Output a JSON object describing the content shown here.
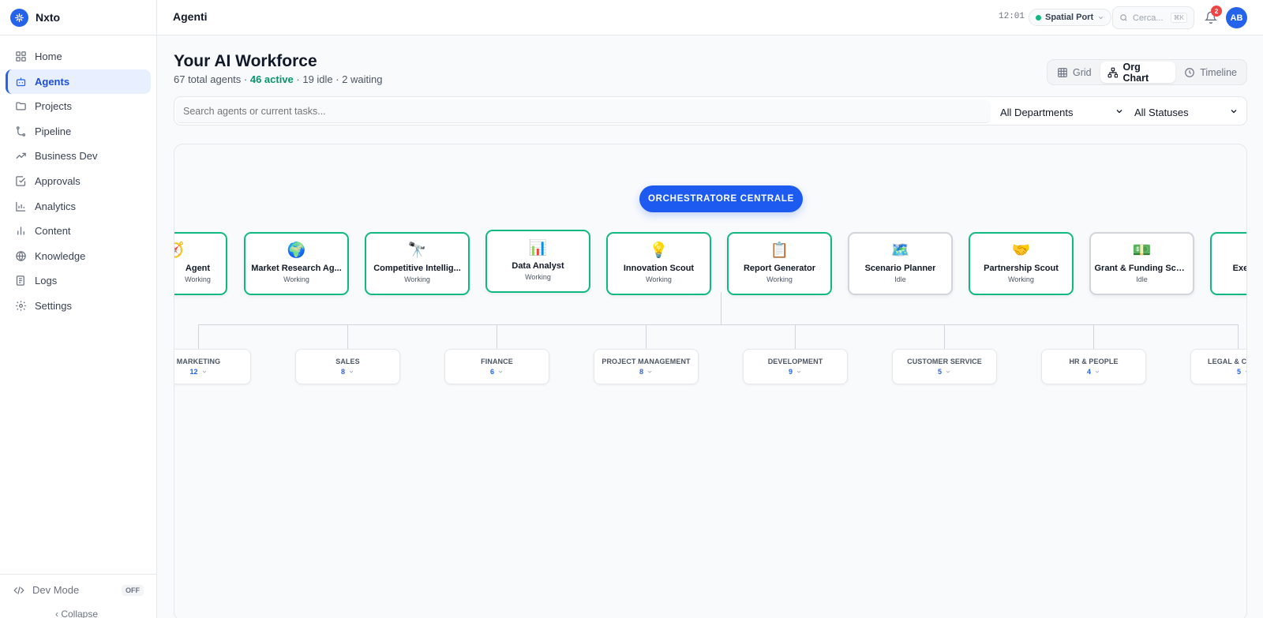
{
  "brand": {
    "name": "Nxto"
  },
  "sidebar": {
    "items": [
      {
        "label": "Home",
        "icon": "grid-icon"
      },
      {
        "label": "Agents",
        "icon": "bot-icon",
        "active": true
      },
      {
        "label": "Projects",
        "icon": "folder-icon"
      },
      {
        "label": "Pipeline",
        "icon": "git-branch-icon"
      },
      {
        "label": "Business Dev",
        "icon": "trending-up-icon"
      },
      {
        "label": "Approvals",
        "icon": "check-square-icon"
      },
      {
        "label": "Analytics",
        "icon": "bar-chart-icon"
      },
      {
        "label": "Content",
        "icon": "bar-chart-small-icon"
      },
      {
        "label": "Knowledge",
        "icon": "globe-icon"
      },
      {
        "label": "Logs",
        "icon": "logs-icon"
      },
      {
        "label": "Settings",
        "icon": "gear-icon"
      }
    ],
    "dev_mode": {
      "label": "Dev Mode",
      "state": "OFF"
    },
    "collapse_label": "‹ Collapse"
  },
  "header": {
    "title": "Agenti",
    "clock": "12:01",
    "workspace": "Spatial Port",
    "search_placeholder": "Cerca...",
    "search_shortcut": "⌘K",
    "notifications_count": "2",
    "avatar_initials": "AB"
  },
  "page": {
    "title": "Your AI Workforce",
    "stats_total": "67 total agents · ",
    "stats_active": "46 active",
    "stats_rest": " · 19 idle · 2 waiting",
    "views": [
      "Grid",
      "Org Chart",
      "Timeline"
    ],
    "active_view": "Org Chart",
    "search_placeholder": "Search agents or current tasks...",
    "department_filter": "All Departments",
    "status_filter": "All Statuses"
  },
  "org_chart": {
    "root": "ORCHESTRATORE CENTRALE",
    "agents": [
      {
        "emoji": "🧭",
        "name": "Agent",
        "status": "Working",
        "state": "working"
      },
      {
        "emoji": "🌍",
        "name": "Market Research Ag...",
        "status": "Working",
        "state": "working"
      },
      {
        "emoji": "🔭",
        "name": "Competitive Intellig...",
        "status": "Working",
        "state": "working"
      },
      {
        "emoji": "📊",
        "name": "Data Analyst",
        "status": "Working",
        "state": "working"
      },
      {
        "emoji": "💡",
        "name": "Innovation Scout",
        "status": "Working",
        "state": "working"
      },
      {
        "emoji": "📋",
        "name": "Report Generator",
        "status": "Working",
        "state": "working"
      },
      {
        "emoji": "🗺️",
        "name": "Scenario Planner",
        "status": "Idle",
        "state": "idle"
      },
      {
        "emoji": "🤝",
        "name": "Partnership Scout",
        "status": "Working",
        "state": "working"
      },
      {
        "emoji": "💵",
        "name": "Grant & Funding Scout",
        "status": "Idle",
        "state": "idle"
      },
      {
        "emoji": "",
        "name": "Exec",
        "status": "",
        "state": "working"
      }
    ],
    "departments": [
      {
        "name": "MARKETING",
        "count": "12"
      },
      {
        "name": "SALES",
        "count": "8"
      },
      {
        "name": "FINANCE",
        "count": "6"
      },
      {
        "name": "PROJECT MANAGEMENT",
        "count": "8"
      },
      {
        "name": "DEVELOPMENT",
        "count": "9"
      },
      {
        "name": "CUSTOMER SERVICE",
        "count": "5"
      },
      {
        "name": "HR & PEOPLE",
        "count": "4"
      },
      {
        "name": "LEGAL & CO",
        "count": "5"
      }
    ]
  }
}
